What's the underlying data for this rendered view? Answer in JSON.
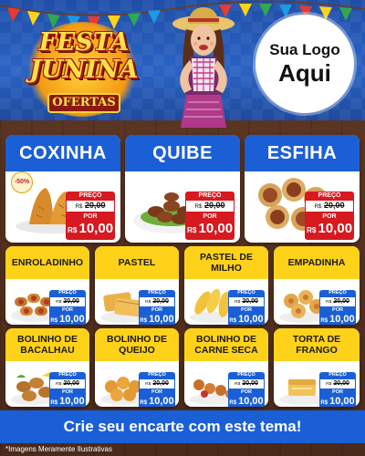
{
  "header": {
    "logo_title_line1": "FESTA",
    "logo_title_line2": "JUNINA",
    "logo_subtitle": "OFERTAS",
    "own_logo_line1": "Sua Logo",
    "own_logo_line2": "Aqui"
  },
  "featured": [
    {
      "name": "COXINHA",
      "badge": "-50%",
      "price_label": "PREÇO",
      "old_currency": "R$",
      "old_price": "20,00",
      "por_label": "POR",
      "new_currency": "R$",
      "new_price": "10,00",
      "food_icon": "coxinha-icon"
    },
    {
      "name": "QUIBE",
      "badge": "",
      "price_label": "PREÇO",
      "old_currency": "R$",
      "old_price": "20,00",
      "por_label": "POR",
      "new_currency": "R$",
      "new_price": "10,00",
      "food_icon": "kibbeh-icon"
    },
    {
      "name": "ESFIHA",
      "badge": "",
      "price_label": "PREÇO",
      "old_currency": "R$",
      "old_price": "20,00",
      "por_label": "POR",
      "new_currency": "R$",
      "new_price": "10,00",
      "food_icon": "esfiha-icon"
    }
  ],
  "items": [
    {
      "name": "ENROLADINHO",
      "price_label": "PREÇO",
      "old_currency": "R$",
      "old_price": "20,00",
      "por_label": "POR",
      "new_currency": "R$",
      "new_price": "10,00",
      "food_icon": "rolls-icon"
    },
    {
      "name": "PASTEL",
      "price_label": "PREÇO",
      "old_currency": "R$",
      "old_price": "20,00",
      "por_label": "POR",
      "new_currency": "R$",
      "new_price": "10,00",
      "food_icon": "pastel-icon"
    },
    {
      "name": "PASTEL DE MILHO",
      "price_label": "PREÇO",
      "old_currency": "R$",
      "old_price": "20,00",
      "por_label": "POR",
      "new_currency": "R$",
      "new_price": "10,00",
      "food_icon": "corn-pastel-icon"
    },
    {
      "name": "EMPADINHA",
      "price_label": "PREÇO",
      "old_currency": "R$",
      "old_price": "20,00",
      "por_label": "POR",
      "new_currency": "R$",
      "new_price": "10,00",
      "food_icon": "empadinha-icon"
    },
    {
      "name": "BOLINHO DE BACALHAU",
      "price_label": "PREÇO",
      "old_currency": "R$",
      "old_price": "20,00",
      "por_label": "POR",
      "new_currency": "R$",
      "new_price": "10,00",
      "food_icon": "cod-fritter-icon"
    },
    {
      "name": "BOLINHO DE QUEIJO",
      "price_label": "PREÇO",
      "old_currency": "R$",
      "old_price": "20,00",
      "por_label": "POR",
      "new_currency": "R$",
      "new_price": "10,00",
      "food_icon": "cheese-ball-icon"
    },
    {
      "name": "BOLINHO DE CARNE SECA",
      "price_label": "PREÇO",
      "old_currency": "R$",
      "old_price": "20,00",
      "por_label": "POR",
      "new_currency": "R$",
      "new_price": "10,00",
      "food_icon": "meat-fritter-icon"
    },
    {
      "name": "TORTA DE FRANGO",
      "price_label": "PREÇO",
      "old_currency": "R$",
      "old_price": "20,00",
      "por_label": "POR",
      "new_currency": "R$",
      "new_price": "10,00",
      "food_icon": "chicken-pie-icon"
    }
  ],
  "footer": {
    "banner": "Crie seu encarte com este tema!",
    "disclaimer": "*Imagens Meramente Ilustrativas"
  },
  "colors": {
    "blue": "#1a5fd6",
    "yellow": "#ffd21a",
    "red": "#d71920",
    "wood": "#4a2a1a"
  }
}
